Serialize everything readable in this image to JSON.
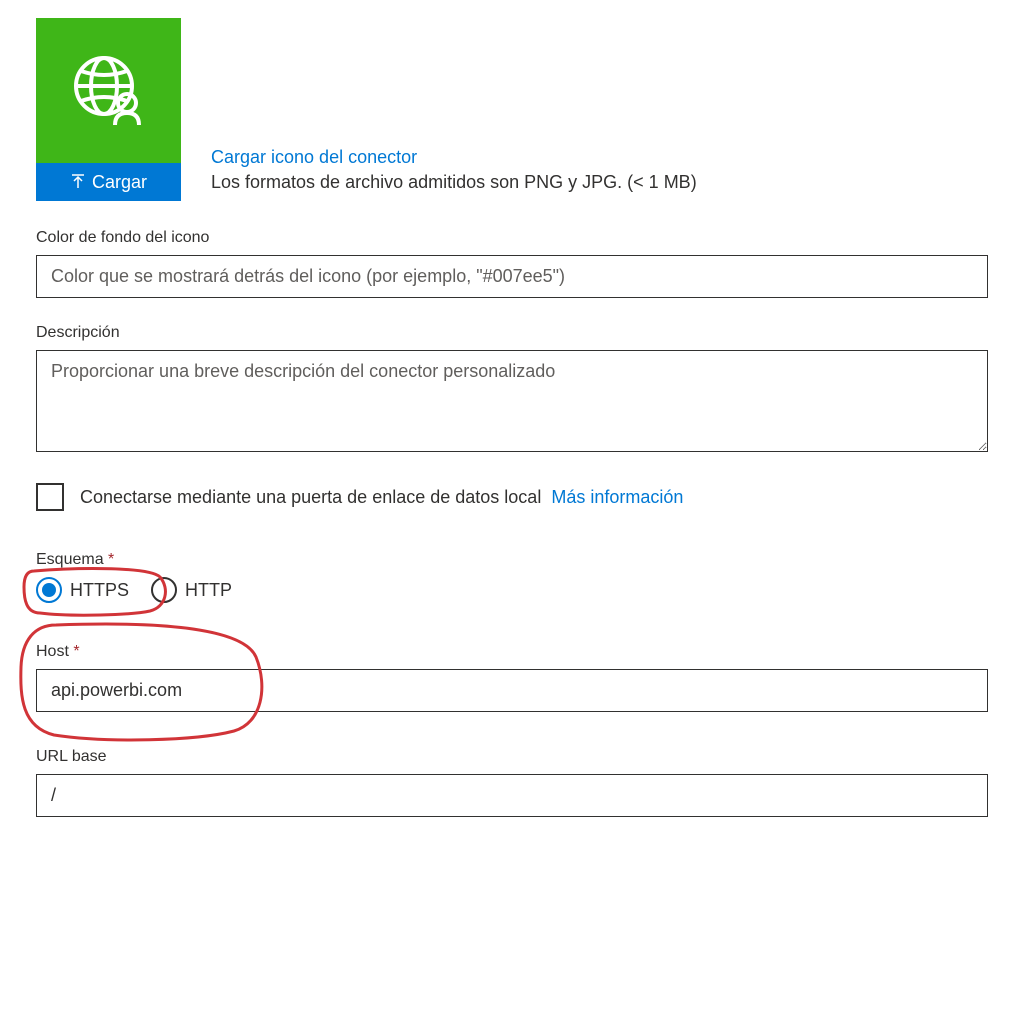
{
  "upload": {
    "button_label": "Cargar",
    "link_text": "Cargar icono del conector",
    "formats_text": "Los formatos de archivo admitidos son PNG y JPG. (< 1 MB)"
  },
  "background_color": {
    "label": "Color de fondo del icono",
    "placeholder": "Color que se mostrará detrás del icono (por ejemplo, \"#007ee5\")",
    "value": ""
  },
  "description": {
    "label": "Descripción",
    "placeholder": "Proporcionar una breve descripción del conector personalizado",
    "value": ""
  },
  "gateway_checkbox": {
    "label": "Conectarse mediante una puerta de enlace de datos local",
    "link_text": "Más información"
  },
  "scheme": {
    "label": "Esquema",
    "options": {
      "https": "HTTPS",
      "http": "HTTP"
    }
  },
  "host": {
    "label": "Host",
    "value": "api.powerbi.com"
  },
  "url_base": {
    "label": "URL base",
    "value": "/"
  }
}
